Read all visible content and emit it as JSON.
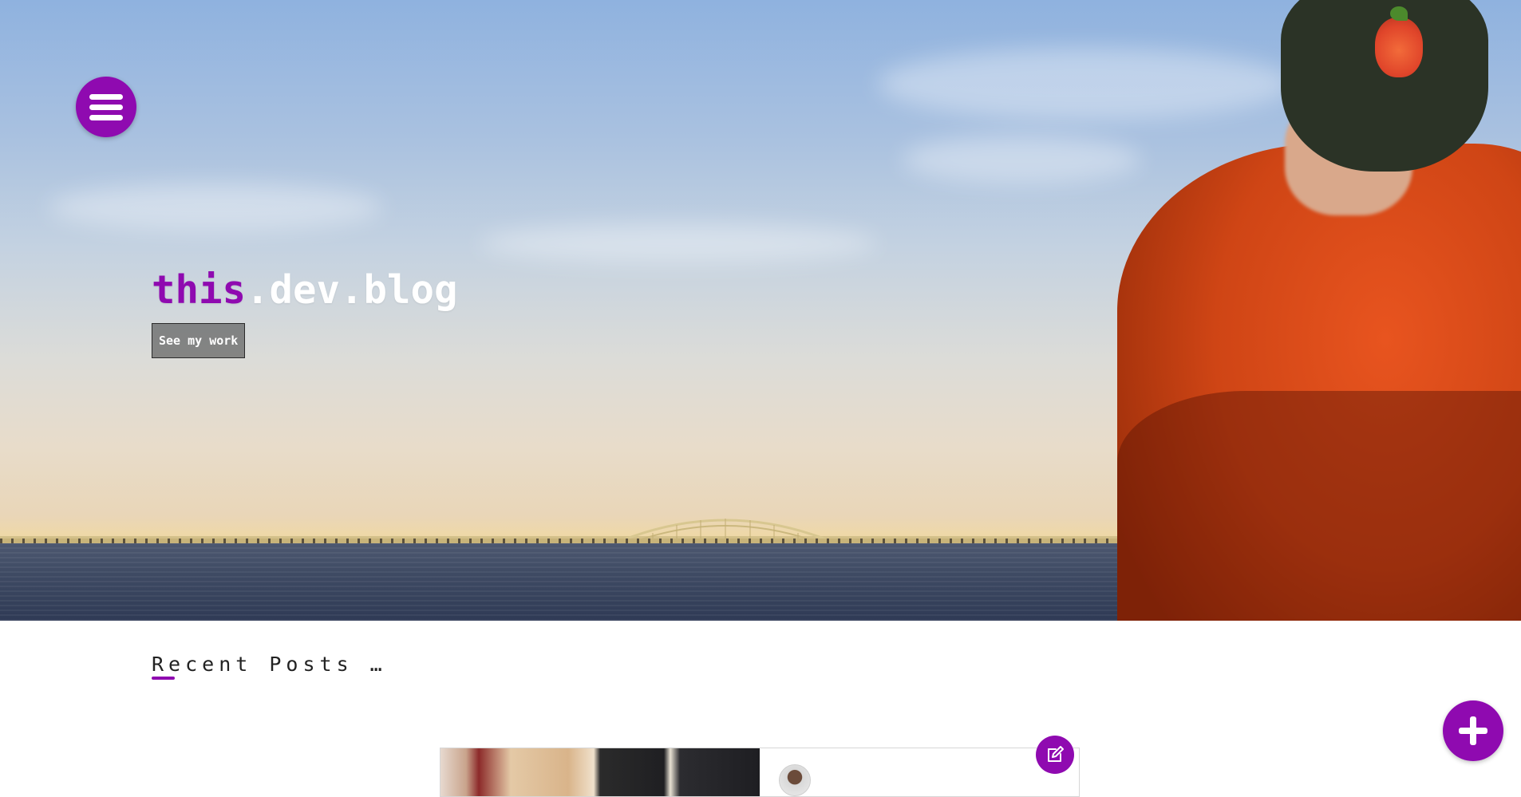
{
  "theme": {
    "accent": "#8f0ab0",
    "text": "#222222",
    "background": "#ffffff"
  },
  "hero": {
    "brand_prefix": "this",
    "brand_suffix": ".dev.blog",
    "cta_label": "See my work",
    "background_image": "bridge-over-water-with-person-in-orange-hoodie"
  },
  "nav": {
    "menu_icon": "hamburger-icon"
  },
  "recent": {
    "title": "Recent Posts …",
    "posts": [
      {
        "image": "food-platter-photo",
        "avatar": "author-avatar",
        "edit_icon": "edit-icon"
      }
    ]
  },
  "fab": {
    "icon": "plus-icon"
  }
}
